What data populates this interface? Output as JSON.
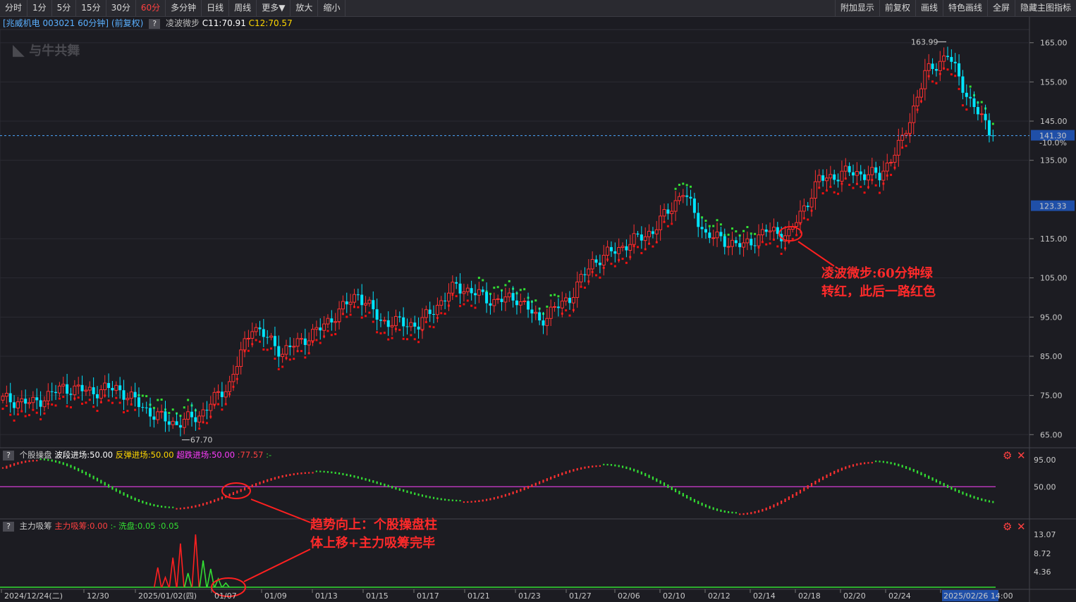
{
  "toolbar": {
    "left": [
      "分时",
      "1分",
      "5分",
      "15分",
      "30分",
      "60分",
      "多分钟",
      "日线",
      "周线",
      "更多▼",
      "放大",
      "缩小"
    ],
    "active": "60分",
    "right": [
      "附加显示",
      "前复权",
      "画线",
      "特色画线",
      "全屏",
      "隐藏主图指标"
    ]
  },
  "info": {
    "stock": "[兆威机电 003021 60分钟]",
    "adj": "(前复权)",
    "indicator": "凌波微步",
    "c1": "C11:70.91",
    "c2": "C12:70.57"
  },
  "logo_text": "与牛共舞",
  "price_axis": {
    "ticks": [
      "165.00",
      "155.00",
      "145.00",
      "135.00",
      "115.00",
      "105.00",
      "95.00",
      "85.00",
      "75.00",
      "65.00"
    ],
    "current_price": "141.30",
    "current_pct": "-10.0%",
    "mark_price": "123.33"
  },
  "chart_data": {
    "type": "candlestick",
    "ylim": [
      62,
      168
    ],
    "high_label": "163.99",
    "low_label": "67.70",
    "anchors": [
      [
        0,
        74
      ],
      [
        8,
        73
      ],
      [
        16,
        77
      ],
      [
        24,
        76
      ],
      [
        30,
        77
      ],
      [
        40,
        70
      ],
      [
        46,
        67.7
      ],
      [
        52,
        70
      ],
      [
        60,
        78
      ],
      [
        66,
        93
      ],
      [
        74,
        86
      ],
      [
        84,
        92
      ],
      [
        94,
        101
      ],
      [
        100,
        94
      ],
      [
        110,
        93
      ],
      [
        120,
        103
      ],
      [
        130,
        99
      ],
      [
        136,
        100
      ],
      [
        142,
        94
      ],
      [
        150,
        100
      ],
      [
        156,
        109
      ],
      [
        166,
        114
      ],
      [
        172,
        117
      ],
      [
        180,
        127
      ],
      [
        186,
        116
      ],
      [
        196,
        113
      ],
      [
        202,
        117
      ],
      [
        208,
        116
      ],
      [
        216,
        130
      ],
      [
        224,
        132
      ],
      [
        232,
        131
      ],
      [
        238,
        140
      ],
      [
        244,
        157
      ],
      [
        250,
        162
      ],
      [
        256,
        150
      ],
      [
        262,
        141.3
      ]
    ],
    "trend_switches": [
      [
        0,
        "red"
      ],
      [
        36,
        "green"
      ],
      [
        52,
        "red"
      ],
      [
        126,
        "green"
      ],
      [
        148,
        "red"
      ],
      [
        178,
        "green"
      ],
      [
        200,
        "red"
      ],
      [
        256,
        "green"
      ]
    ]
  },
  "osc": {
    "label": "个股操盘",
    "v1": "波段进场:50.00",
    "v2": "反弹进场:50.00",
    "v3": "超跌进场:50.00",
    "v4": ":77.57",
    "v5": ":-",
    "ticks": [
      "95.00",
      "50.00"
    ]
  },
  "accum": {
    "label": "主力吸筹",
    "v1": "主力吸筹:0.00",
    "v2": ":-",
    "v3": "洗盘:0.05",
    "v4": ":0.05",
    "ticks": [
      "13.07",
      "8.72",
      "4.36"
    ]
  },
  "dates": [
    "2024/12/24(二)",
    "12/30",
    "2025/01/02(四)",
    "01/07",
    "01/09",
    "01/13",
    "01/15",
    "01/17",
    "01/21",
    "01/23",
    "01/27",
    "02/06",
    "02/10",
    "02/12",
    "02/14",
    "02/18",
    "02/20",
    "02/24",
    "2025/02/26 14:00"
  ],
  "annotations": {
    "a1_line1": "凌波微步:60分钟绿",
    "a1_line2": "转红，此后一路红色",
    "a2_line1": "趋势向上：个股操盘柱",
    "a2_line2": "体上移+主力吸筹完毕"
  },
  "colors": {
    "up": "#ff3030",
    "down": "#00e5ff",
    "green": "#33dd33",
    "accent": "#ff4040"
  }
}
